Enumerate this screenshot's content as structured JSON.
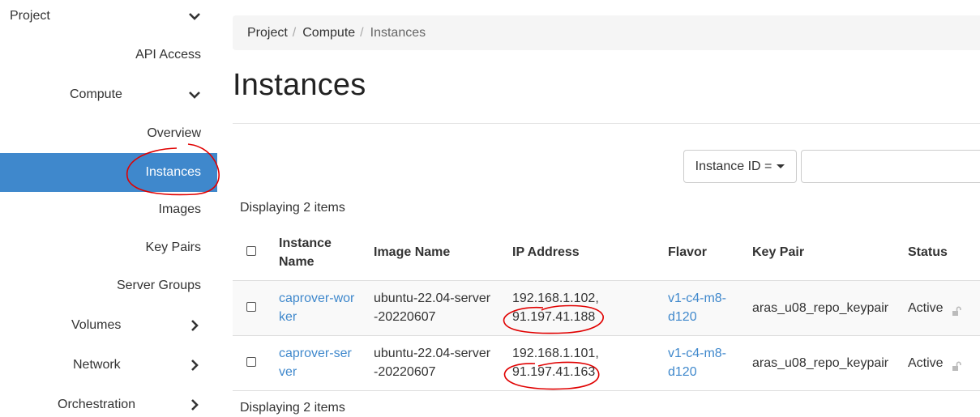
{
  "sidebar": {
    "items": [
      {
        "label": "Project",
        "icon": "chevron-down-icon"
      },
      {
        "label": "API Access"
      },
      {
        "label": "Compute",
        "icon": "chevron-down-icon"
      },
      {
        "label": "Overview"
      },
      {
        "label": "Instances",
        "active": true
      },
      {
        "label": "Images"
      },
      {
        "label": "Key Pairs"
      },
      {
        "label": "Server Groups"
      },
      {
        "label": "Volumes",
        "icon": "chevron-right-icon"
      },
      {
        "label": "Network",
        "icon": "chevron-right-icon"
      },
      {
        "label": "Orchestration",
        "icon": "chevron-right-icon"
      }
    ]
  },
  "breadcrumb": {
    "project": "Project",
    "compute": "Compute",
    "instances": "Instances",
    "separator": "/"
  },
  "page": {
    "title": "Instances"
  },
  "filter": {
    "field_label": "Instance ID =",
    "input_value": ""
  },
  "table": {
    "count_text": "Displaying 2 items",
    "headers": {
      "name_line1": "Instance",
      "name_line2": "Name",
      "image": "Image Name",
      "ip": "IP Address",
      "flavor": "Flavor",
      "keypair": "Key Pair",
      "status": "Status"
    },
    "rows": [
      {
        "name_line1": "caprover-wor",
        "name_line2": "ker",
        "image_line1": "ubuntu-22.04-server",
        "image_line2": "-20220607",
        "ip_line1": "192.168.1.102,",
        "ip_line2": "91.197.41.188",
        "flavor_line1": "v1-c4-m8-",
        "flavor_line2": "d120",
        "keypair": "aras_u08_repo_keypair",
        "status": "Active"
      },
      {
        "name_line1": "caprover-ser",
        "name_line2": "ver",
        "image_line1": "ubuntu-22.04-server",
        "image_line2": "-20220607",
        "ip_line1": "192.168.1.101,",
        "ip_line2": "91.197.41.163",
        "flavor_line1": "v1-c4-m8-",
        "flavor_line2": "d120",
        "keypair": "aras_u08_repo_keypair",
        "status": "Active"
      }
    ]
  },
  "colors": {
    "active_nav": "#3f88cc",
    "link": "#3f88cc",
    "annotation": "#e00000"
  }
}
